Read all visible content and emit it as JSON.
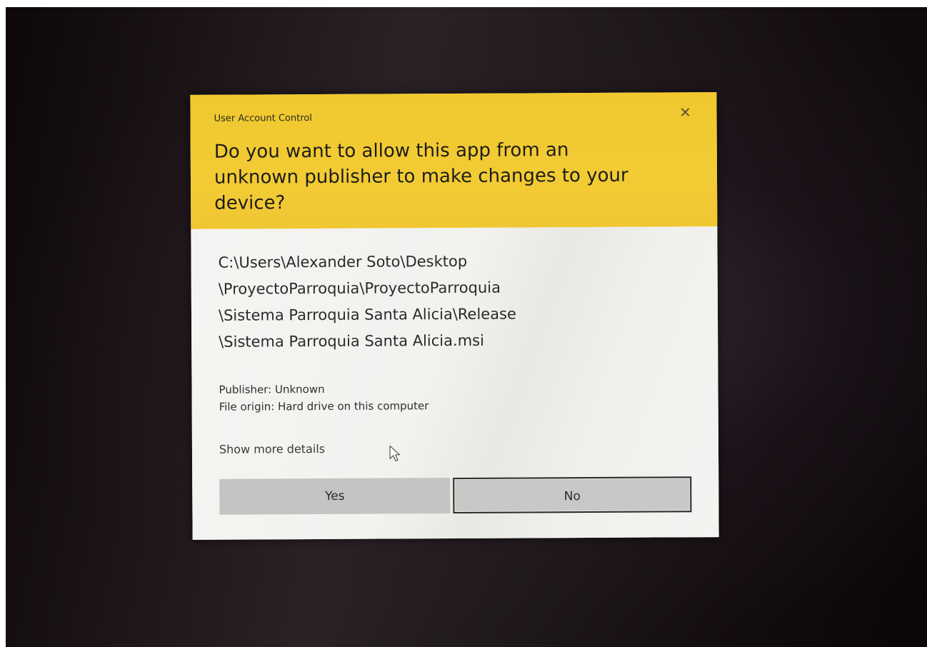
{
  "dialog": {
    "header_label": "User Account Control",
    "close_glyph": "×",
    "question_lines": [
      "Do you want to allow this app from an",
      "unknown publisher to make changes to your",
      "device?"
    ],
    "program_path_lines": [
      "C:\\Users\\Alexander Soto\\Desktop",
      "\\ProyectoParroquia\\ProyectoParroquia",
      "\\Sistema Parroquia Santa Alicia\\Release",
      "\\Sistema Parroquia Santa Alicia.msi"
    ],
    "publisher": "Publisher: Unknown",
    "file_origin": "File origin: Hard drive on this computer",
    "show_details_label": "Show more details",
    "yes_label": "Yes",
    "no_label": "No"
  },
  "colors": {
    "header_yellow": "#f2cb35",
    "body_background": "#f1f1ee",
    "button_gray": "#c4c4c2"
  },
  "icons": {
    "close": "close-icon",
    "cursor": "mouse-pointer-icon"
  }
}
